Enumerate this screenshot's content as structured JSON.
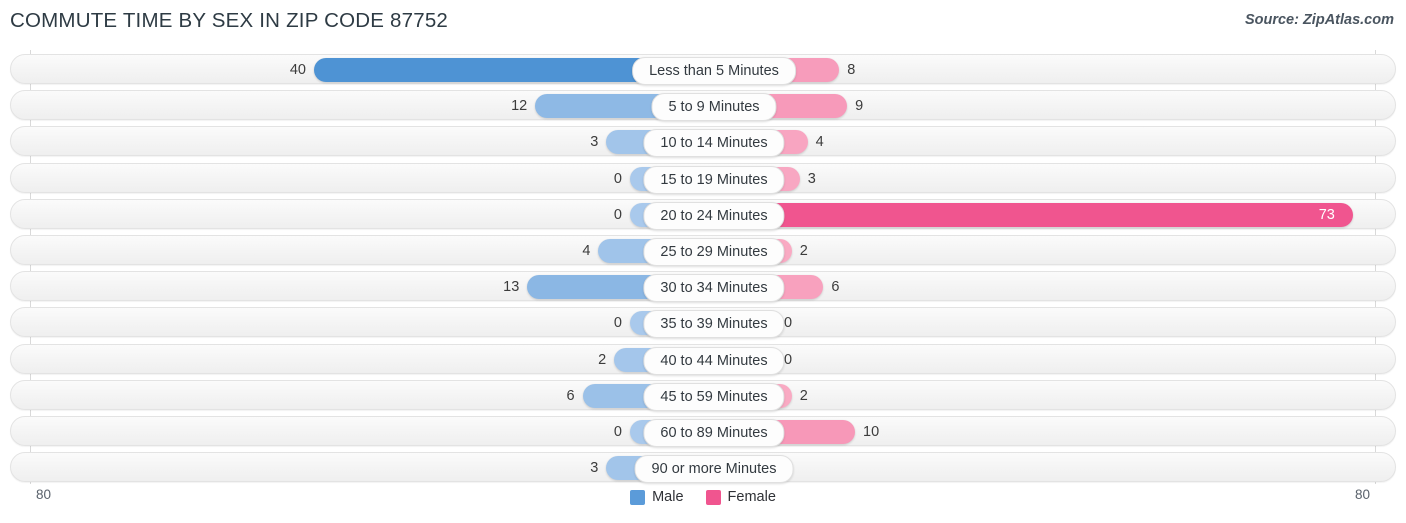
{
  "header": {
    "title": "COMMUTE TIME BY SEX IN ZIP CODE 87752",
    "source": "Source: ZipAtlas.com"
  },
  "axis": {
    "left_tick": "80",
    "right_tick": "80"
  },
  "legend": {
    "items": [
      {
        "label": "Male",
        "color": "#5b9bd9"
      },
      {
        "label": "Female",
        "color": "#f0558f"
      }
    ]
  },
  "chart_data": {
    "type": "bar",
    "orientation": "horizontal-diverging",
    "title": "COMMUTE TIME BY SEX IN ZIP CODE 87752",
    "xlabel": "",
    "ylabel": "",
    "xlim": [
      80,
      80
    ],
    "grid": false,
    "legend_position": "bottom-center",
    "categories": [
      "Less than 5 Minutes",
      "5 to 9 Minutes",
      "10 to 14 Minutes",
      "15 to 19 Minutes",
      "20 to 24 Minutes",
      "25 to 29 Minutes",
      "30 to 34 Minutes",
      "35 to 39 Minutes",
      "40 to 44 Minutes",
      "45 to 59 Minutes",
      "60 to 89 Minutes",
      "90 or more Minutes"
    ],
    "series": [
      {
        "name": "Male",
        "values": [
          40,
          12,
          3,
          0,
          0,
          4,
          13,
          0,
          2,
          6,
          0,
          3
        ]
      },
      {
        "name": "Female",
        "values": [
          8,
          9,
          4,
          3,
          73,
          2,
          6,
          0,
          0,
          2,
          10,
          0
        ]
      }
    ]
  },
  "rows": [
    {
      "label": "Less than 5 Minutes",
      "male": "40",
      "female": "8"
    },
    {
      "label": "5 to 9 Minutes",
      "male": "12",
      "female": "9"
    },
    {
      "label": "10 to 14 Minutes",
      "male": "3",
      "female": "4"
    },
    {
      "label": "15 to 19 Minutes",
      "male": "0",
      "female": "3"
    },
    {
      "label": "20 to 24 Minutes",
      "male": "0",
      "female": "73"
    },
    {
      "label": "25 to 29 Minutes",
      "male": "4",
      "female": "2"
    },
    {
      "label": "30 to 34 Minutes",
      "male": "13",
      "female": "6"
    },
    {
      "label": "35 to 39 Minutes",
      "male": "0",
      "female": "0"
    },
    {
      "label": "40 to 44 Minutes",
      "male": "2",
      "female": "0"
    },
    {
      "label": "45 to 59 Minutes",
      "male": "6",
      "female": "2"
    },
    {
      "label": "60 to 89 Minutes",
      "male": "0",
      "female": "10"
    },
    {
      "label": "90 or more Minutes",
      "male": "3",
      "female": "0"
    }
  ]
}
